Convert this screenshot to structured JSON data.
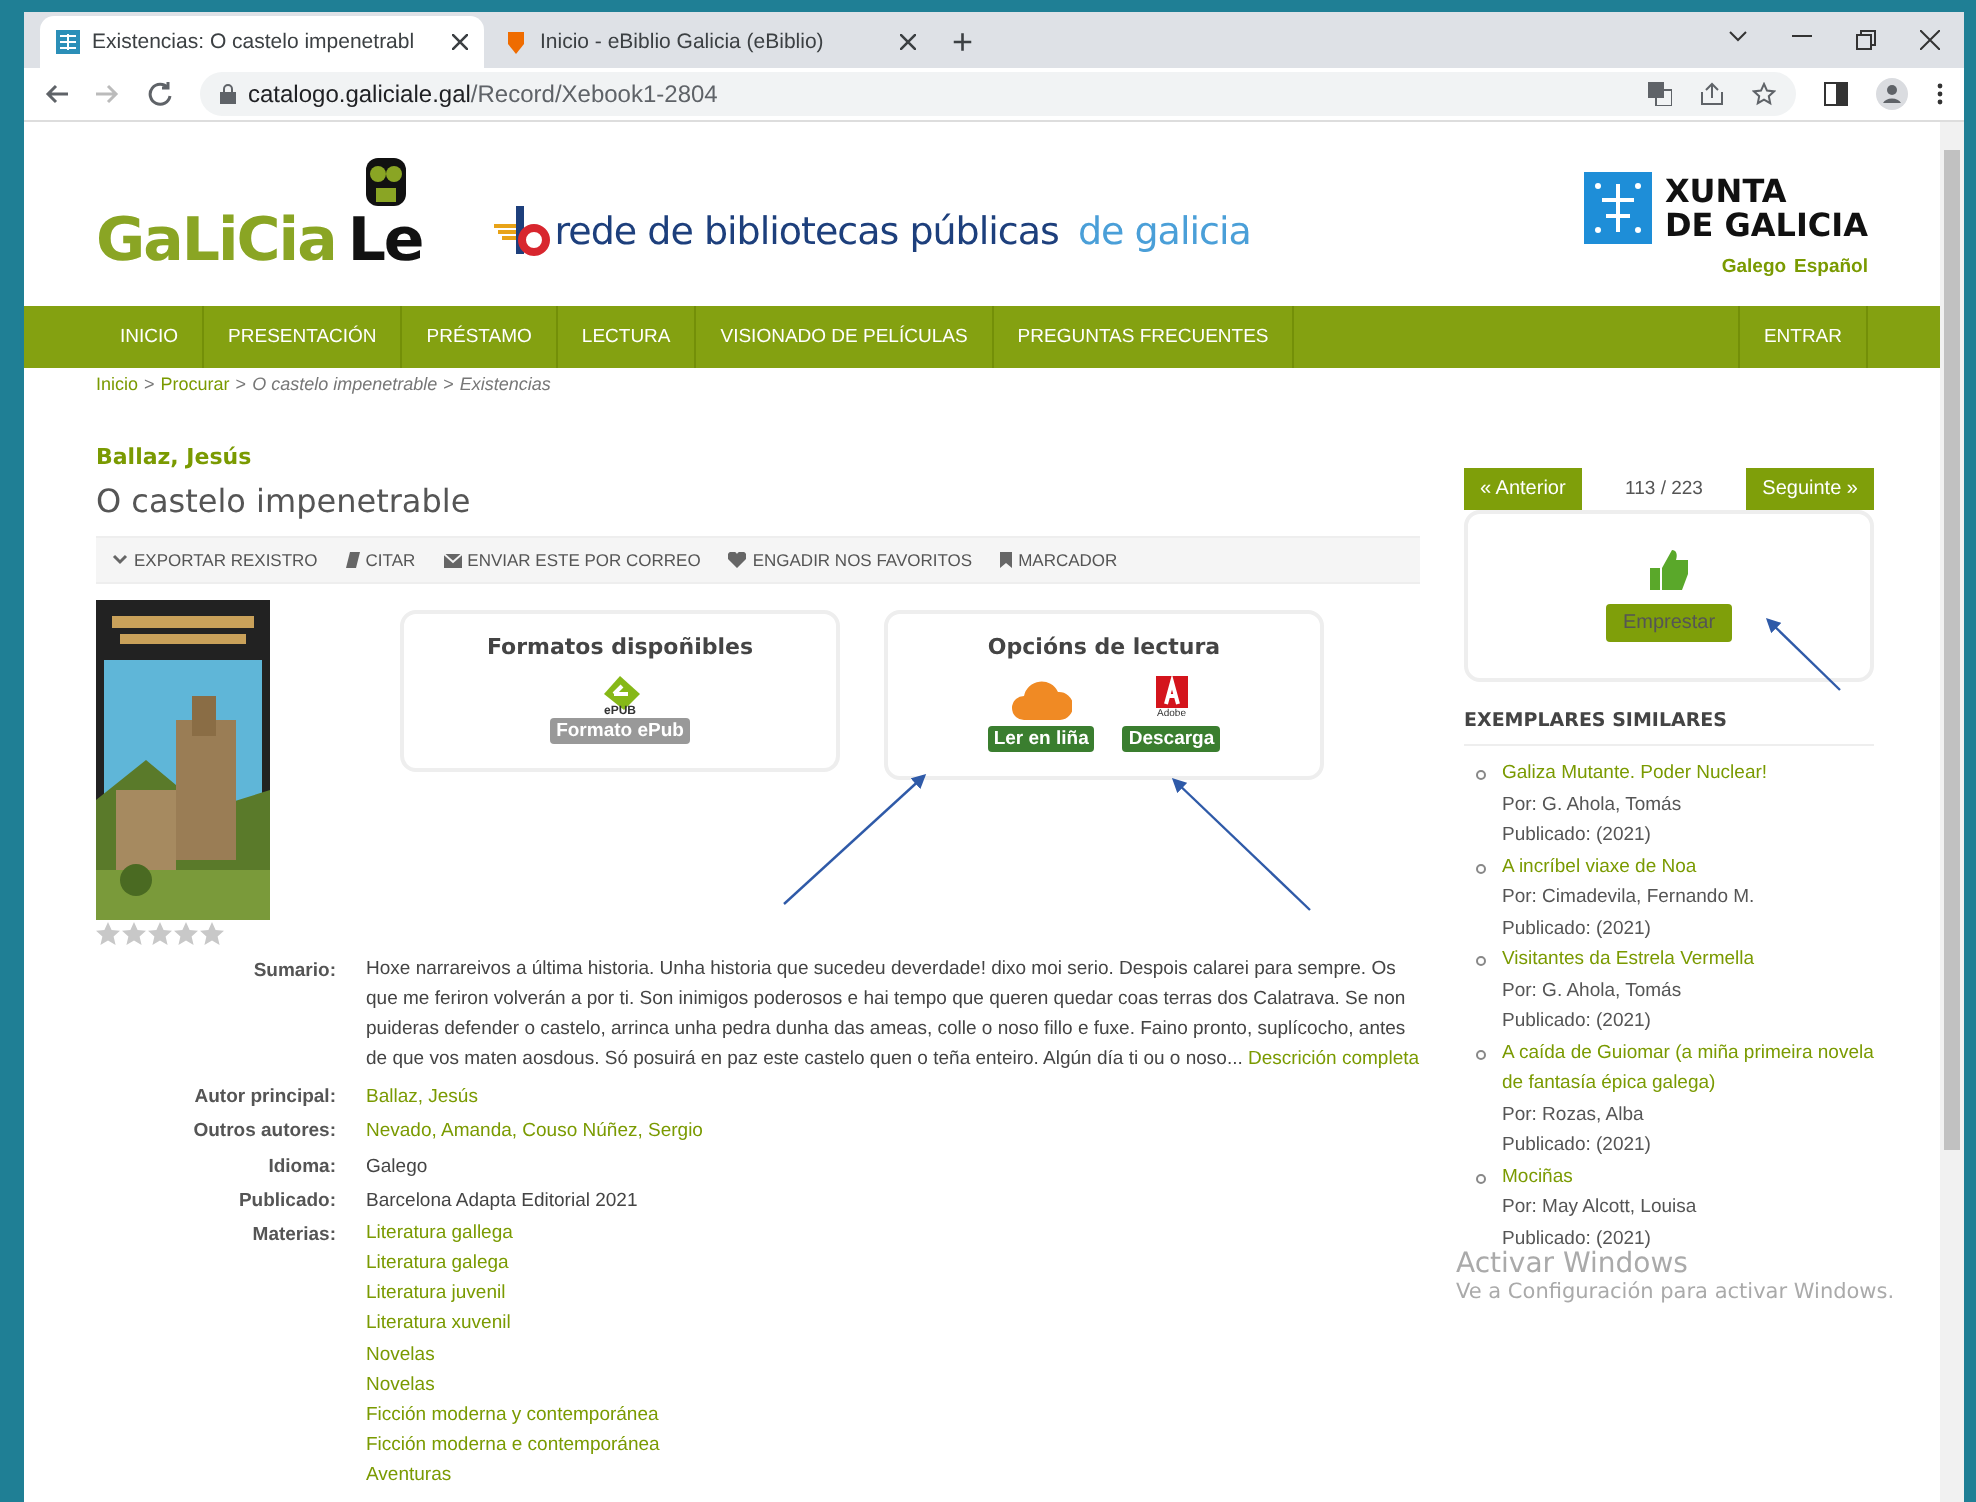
{
  "browser": {
    "tabs": [
      {
        "title": "Existencias: O castelo impenetrabl",
        "selected": true
      },
      {
        "title": "Inicio - eBiblio Galicia (eBiblio)",
        "selected": false
      }
    ],
    "new_tab": "+",
    "url_host": "catalogo.galiciale.gal",
    "url_path": "/Record/Xebook1-2804"
  },
  "header": {
    "logo": [
      "GaLiCia",
      "Le"
    ],
    "network": [
      "rede de bibliotecas públicas",
      "de galicia"
    ],
    "xunta": [
      "XUNTA",
      "DE GALICIA"
    ],
    "languages": [
      "Galego",
      "Español"
    ]
  },
  "nav": {
    "items": [
      "INICIO",
      "PRESENTACIÓN",
      "PRÉSTAMO",
      "LECTURA",
      "VISIONADO DE PELÍCULAS",
      "PREGUNTAS FRECUENTES"
    ],
    "login": "ENTRAR"
  },
  "breadcrumb": [
    {
      "label": "Inicio",
      "link": true
    },
    {
      "label": "Procurar",
      "link": true
    },
    {
      "label": "O castelo impenetrable",
      "link": false
    },
    {
      "label": "Existencias",
      "link": false
    }
  ],
  "breadcrumb_separators": [
    ">",
    ">",
    ">"
  ],
  "record": {
    "author": "Ballaz, Jesús",
    "title": "O castelo impenetrable",
    "actions": [
      {
        "label": "EXPORTAR REXISTRO",
        "kind": "chevron"
      },
      {
        "label": "CITAR",
        "kind": "book"
      },
      {
        "label": "ENVIAR ESTE POR CORREO",
        "kind": "mail"
      },
      {
        "label": "ENGADIR NOS FAVORITOS",
        "kind": "heart"
      },
      {
        "label": "MARCADOR",
        "kind": "bookmark"
      }
    ],
    "stars": 0,
    "formats": {
      "title": "Formatos dispoñibles",
      "logo_text": "ePUB",
      "label": "Formato ePub"
    },
    "reading": {
      "title": "Opcións de lectura",
      "options": [
        {
          "kind": "cloud",
          "label": "Ler en liña"
        },
        {
          "kind": "adobe",
          "logo_text": "Adobe",
          "label": "Descarga"
        }
      ]
    },
    "details": [
      {
        "label": "Sumario:",
        "values": [
          {
            "text": "Hoxe narrareivos a última historia. Unha historia que sucedeu deverdade! dixo moi serio. Despois calarei para sempre. Os que me feriron volverán a por ti. Son inimigos poderosos e hai tempo que queren quedar coas terras dos Calatrava. Se non puideras defender o castelo, arrinca unha pedra dunha das ameas, colle o noso fillo e fuxe. Faino pronto, suplícocho, antes de que vos maten aosdous. Só posuirá en paz este castelo quen o teña enteiro. Algún día ti ou o noso...",
            "more": "Descrición completa"
          }
        ]
      },
      {
        "label": "Autor principal:",
        "values": [
          {
            "text": "Ballaz, Jesús",
            "link": true
          }
        ]
      },
      {
        "label": "Outros autores:",
        "values": [
          {
            "text": "Nevado, Amanda, Couso Núñez, Sergio",
            "link": true
          }
        ]
      },
      {
        "label": "Idioma:",
        "values": [
          {
            "text": "Galego",
            "link": false
          }
        ]
      },
      {
        "label": "Publicado:",
        "values": [
          {
            "text": "Barcelona Adapta Editorial 2021",
            "link": false
          }
        ]
      },
      {
        "label": "Materias:",
        "values": [
          {
            "text": "Literatura gallega",
            "link": true
          },
          {
            "text": "Literatura galega",
            "link": true
          },
          {
            "text": "Literatura juvenil",
            "link": true
          },
          {
            "text": "Literatura xuvenil",
            "link": true
          },
          {
            "text": "Novelas",
            "link": true
          },
          {
            "text": "Novelas",
            "link": true
          },
          {
            "text": "Ficción moderna y contemporánea",
            "link": true
          },
          {
            "text": "Ficción moderna e contemporánea",
            "link": true
          },
          {
            "text": "Aventuras",
            "link": true
          }
        ]
      }
    ]
  },
  "sidebar": {
    "prev": "« Anterior",
    "position": "113 / 223",
    "next": "Seguinte »",
    "loan": "Emprestar",
    "similar_title": "EXEMPLARES SIMILARES",
    "similar": [
      {
        "title": "Galiza Mutante. Poder Nuclear!",
        "by": "Por: G. Ahola, Tomás",
        "published": "Publicado: (2021)"
      },
      {
        "title": "A incríbel viaxe de Noa",
        "by": "Por: Cimadevila, Fernando M.",
        "published": "Publicado: (2021)"
      },
      {
        "title": "Visitantes da Estrela Vermella",
        "by": "Por: G. Ahola, Tomás",
        "published": "Publicado: (2021)"
      },
      {
        "title": "A caída de Guiomar (a miña primeira novela de fantasía épica galega)",
        "by": "Por: Rozas, Alba",
        "published": "Publicado: (2021)"
      },
      {
        "title": "Mociñas",
        "by": "Por: May Alcott, Louisa",
        "published": "Publicado: (2021)"
      }
    ]
  },
  "os_notice": {
    "title": "Activar Windows",
    "text": "Ve a Configuración para activar Windows."
  }
}
